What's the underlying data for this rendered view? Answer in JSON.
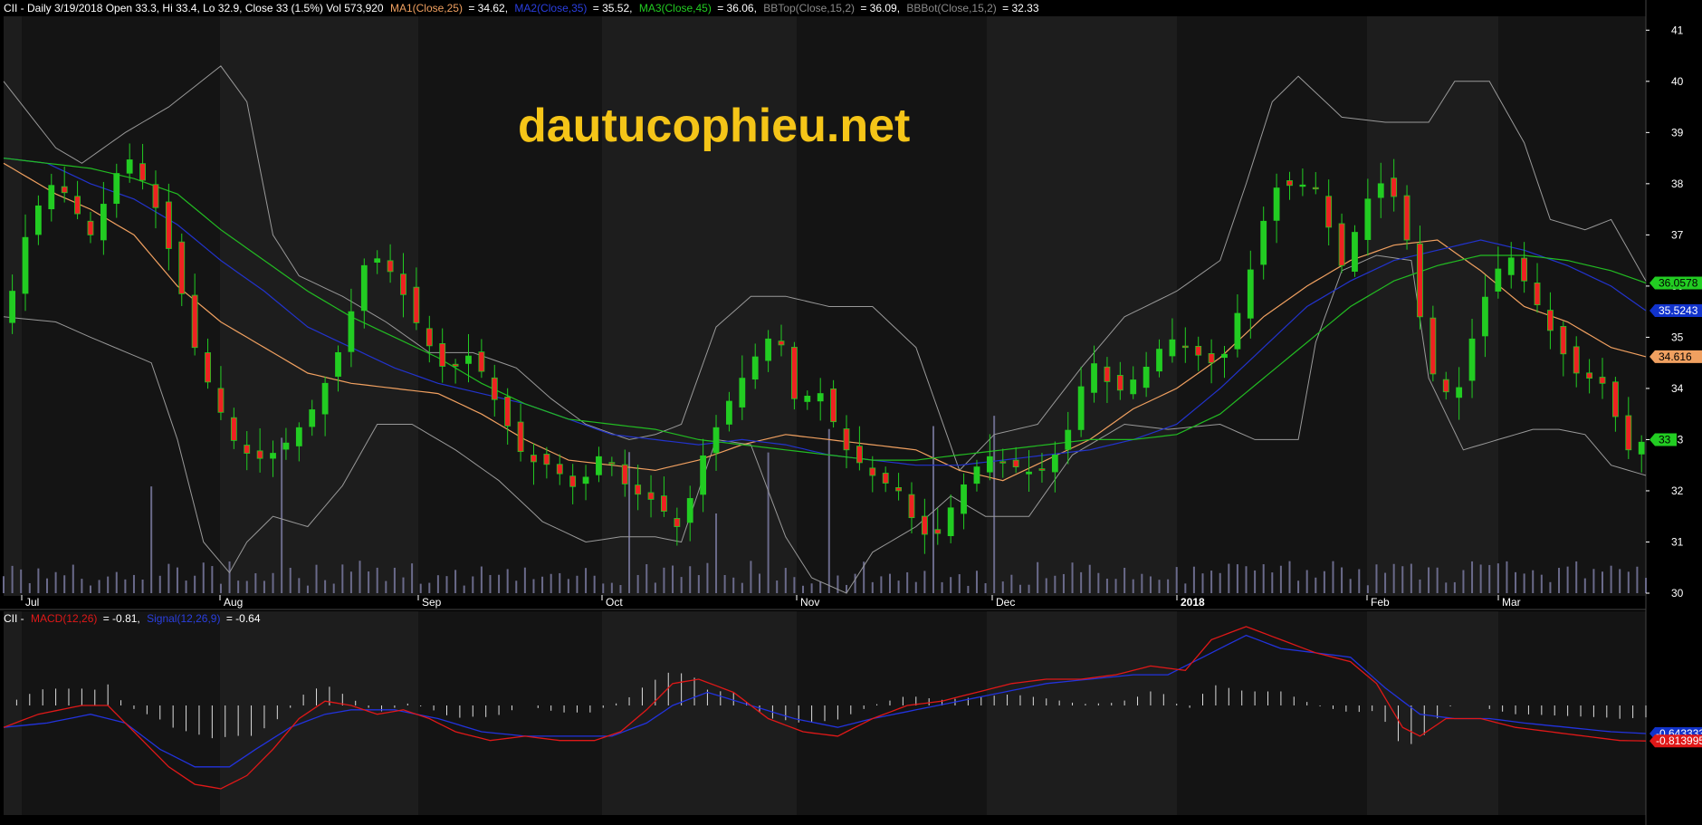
{
  "header": {
    "main_prefix": "CII - Daily 3/19/2018 Open 33.3, Hi 33.4, Lo 32.9, Close 33 (1.5%) Vol 573,920",
    "ma1_label": "MA1(Close,25)",
    "ma1_value": "= 34.62,",
    "ma2_label": "MA2(Close,35)",
    "ma2_value": "= 35.52,",
    "ma3_label": "MA3(Close,45)",
    "ma3_value": "= 36.06,",
    "bbtop_label": "BBTop(Close,15,2)",
    "bbtop_value": "= 36.09,",
    "bbbot_label": "BBBot(Close,15,2)",
    "bbbot_value": "= 32.33"
  },
  "macd_header": {
    "prefix": "CII -",
    "macd_label": "MACD(12,26)",
    "macd_value": "= -0.81,",
    "signal_label": "Signal(12,26,9)",
    "signal_value": "= -0.64"
  },
  "watermark": "dautucophieu.net",
  "colors": {
    "background": "#000000",
    "band_dark": "#141414",
    "band_light": "#1d1d1d",
    "up_candle": "#22cc22",
    "down_candle": "#ee2222",
    "ma1": "#f0a060",
    "ma2": "#2233cc",
    "ma3": "#22bb22",
    "bollinger": "#999999",
    "volume": "#6a6a8a",
    "macd": "#e01818",
    "signal": "#2233dd",
    "histogram": "#dddddd",
    "watermark": "#f5c518"
  },
  "price_tags": [
    {
      "label": "36.0578",
      "value": 36.06,
      "bg": "#22cc22",
      "fg": "#000000"
    },
    {
      "label": "35.5243",
      "value": 35.52,
      "bg": "#1133cc",
      "fg": "#ffffff"
    },
    {
      "label": "34.616",
      "value": 34.62,
      "bg": "#f0a060",
      "fg": "#000000"
    },
    {
      "label": "33",
      "value": 33.0,
      "bg": "#22cc22",
      "fg": "#000000"
    }
  ],
  "macd_tags": [
    {
      "label": "-0.643333",
      "value": -0.64,
      "bg": "#1133cc",
      "fg": "#ffffff"
    },
    {
      "label": "-0.813995",
      "value": -0.81,
      "bg": "#e01818",
      "fg": "#ffffff"
    }
  ],
  "chart_data": {
    "type": "candlestick",
    "title": "CII - Daily 3/19/2018",
    "y_ticks": [
      30,
      31,
      32,
      33,
      34,
      35,
      36,
      37,
      38,
      39,
      40,
      41
    ],
    "ylim": [
      30,
      41.2
    ],
    "months": [
      "Jul",
      "Aug",
      "Sep",
      "Oct",
      "Nov",
      "Dec",
      "2018",
      "Feb",
      "Mar"
    ],
    "close_path": [
      [
        0,
        35.2
      ],
      [
        6,
        37.3
      ],
      [
        12,
        38.1
      ],
      [
        20,
        37.0
      ],
      [
        28,
        38.6
      ],
      [
        34,
        37.8
      ],
      [
        40,
        36.2
      ],
      [
        44,
        34.8
      ],
      [
        48,
        33.9
      ],
      [
        54,
        32.8
      ],
      [
        60,
        32.6
      ],
      [
        66,
        33.0
      ],
      [
        72,
        33.7
      ],
      [
        78,
        34.9
      ],
      [
        84,
        36.7
      ],
      [
        90,
        36.2
      ],
      [
        96,
        35.1
      ],
      [
        102,
        34.3
      ],
      [
        108,
        34.7
      ],
      [
        114,
        33.6
      ],
      [
        120,
        32.6
      ],
      [
        126,
        32.5
      ],
      [
        132,
        32.0
      ],
      [
        138,
        32.8
      ],
      [
        144,
        32.0
      ],
      [
        150,
        31.8
      ],
      [
        156,
        31.2
      ],
      [
        160,
        32.5
      ],
      [
        166,
        33.6
      ],
      [
        172,
        34.5
      ],
      [
        178,
        35.2
      ],
      [
        182,
        33.8
      ],
      [
        188,
        33.9
      ],
      [
        194,
        32.8
      ],
      [
        200,
        32.3
      ],
      [
        206,
        32.0
      ],
      [
        210,
        31.3
      ],
      [
        214,
        31.0
      ],
      [
        220,
        32.0
      ],
      [
        226,
        32.7
      ],
      [
        232,
        32.5
      ],
      [
        238,
        32.3
      ],
      [
        244,
        32.9
      ],
      [
        250,
        34.6
      ],
      [
        256,
        33.9
      ],
      [
        262,
        34.3
      ],
      [
        268,
        35.0
      ],
      [
        274,
        34.7
      ],
      [
        280,
        34.4
      ],
      [
        286,
        36.0
      ],
      [
        292,
        37.9
      ],
      [
        298,
        38.0
      ],
      [
        302,
        37.9
      ],
      [
        308,
        36.4
      ],
      [
        314,
        37.7
      ],
      [
        318,
        38.1
      ],
      [
        322,
        37.4
      ],
      [
        328,
        34.4
      ],
      [
        334,
        33.7
      ],
      [
        340,
        35.6
      ],
      [
        346,
        36.7
      ],
      [
        352,
        35.8
      ],
      [
        358,
        34.8
      ],
      [
        362,
        34.3
      ],
      [
        368,
        34.1
      ],
      [
        374,
        32.8
      ],
      [
        378,
        33.0
      ]
    ],
    "bb_top_path": [
      [
        0,
        40.0
      ],
      [
        12,
        38.7
      ],
      [
        18,
        38.4
      ],
      [
        28,
        39.0
      ],
      [
        38,
        39.5
      ],
      [
        44,
        39.9
      ],
      [
        50,
        40.3
      ],
      [
        56,
        39.6
      ],
      [
        62,
        37.0
      ],
      [
        68,
        36.2
      ],
      [
        78,
        35.8
      ],
      [
        88,
        35.3
      ],
      [
        98,
        34.7
      ],
      [
        108,
        34.7
      ],
      [
        118,
        34.4
      ],
      [
        126,
        33.8
      ],
      [
        134,
        33.3
      ],
      [
        144,
        33.0
      ],
      [
        150,
        33.1
      ],
      [
        156,
        33.3
      ],
      [
        164,
        35.2
      ],
      [
        172,
        35.8
      ],
      [
        180,
        35.8
      ],
      [
        190,
        35.6
      ],
      [
        200,
        35.6
      ],
      [
        210,
        34.8
      ],
      [
        220,
        32.4
      ],
      [
        228,
        33.1
      ],
      [
        238,
        33.3
      ],
      [
        248,
        34.4
      ],
      [
        258,
        35.4
      ],
      [
        270,
        35.9
      ],
      [
        280,
        36.5
      ],
      [
        286,
        38.0
      ],
      [
        292,
        39.6
      ],
      [
        298,
        40.1
      ],
      [
        308,
        39.3
      ],
      [
        318,
        39.2
      ],
      [
        328,
        39.2
      ],
      [
        334,
        40.0
      ],
      [
        342,
        40.0
      ],
      [
        350,
        38.8
      ],
      [
        356,
        37.3
      ],
      [
        364,
        37.1
      ],
      [
        370,
        37.3
      ],
      [
        378,
        36.1
      ]
    ],
    "bb_bot_path": [
      [
        0,
        35.4
      ],
      [
        12,
        35.3
      ],
      [
        20,
        35.0
      ],
      [
        34,
        34.5
      ],
      [
        40,
        33.0
      ],
      [
        46,
        31.0
      ],
      [
        52,
        30.4
      ],
      [
        56,
        31.0
      ],
      [
        62,
        31.5
      ],
      [
        70,
        31.3
      ],
      [
        78,
        32.1
      ],
      [
        86,
        33.3
      ],
      [
        94,
        33.3
      ],
      [
        104,
        32.8
      ],
      [
        114,
        32.2
      ],
      [
        124,
        31.4
      ],
      [
        134,
        31.0
      ],
      [
        142,
        31.1
      ],
      [
        150,
        31.1
      ],
      [
        156,
        31.0
      ],
      [
        164,
        33.0
      ],
      [
        172,
        32.9
      ],
      [
        180,
        31.1
      ],
      [
        186,
        30.3
      ],
      [
        194,
        30.0
      ],
      [
        200,
        30.8
      ],
      [
        210,
        31.3
      ],
      [
        218,
        31.9
      ],
      [
        226,
        31.5
      ],
      [
        236,
        31.5
      ],
      [
        246,
        32.7
      ],
      [
        258,
        33.3
      ],
      [
        268,
        33.2
      ],
      [
        280,
        33.3
      ],
      [
        288,
        33.0
      ],
      [
        298,
        33.0
      ],
      [
        302,
        34.9
      ],
      [
        308,
        36.3
      ],
      [
        316,
        36.6
      ],
      [
        324,
        36.5
      ],
      [
        328,
        34.2
      ],
      [
        336,
        32.8
      ],
      [
        344,
        33.0
      ],
      [
        352,
        33.2
      ],
      [
        358,
        33.2
      ],
      [
        364,
        33.1
      ],
      [
        370,
        32.5
      ],
      [
        378,
        32.3
      ]
    ],
    "ma1_path": [
      [
        0,
        38.4
      ],
      [
        12,
        37.8
      ],
      [
        20,
        37.5
      ],
      [
        30,
        37.0
      ],
      [
        40,
        36.0
      ],
      [
        50,
        35.3
      ],
      [
        60,
        34.8
      ],
      [
        70,
        34.3
      ],
      [
        80,
        34.1
      ],
      [
        90,
        34.0
      ],
      [
        100,
        33.9
      ],
      [
        110,
        33.5
      ],
      [
        120,
        33.0
      ],
      [
        130,
        32.6
      ],
      [
        140,
        32.5
      ],
      [
        150,
        32.4
      ],
      [
        160,
        32.6
      ],
      [
        170,
        32.9
      ],
      [
        180,
        33.1
      ],
      [
        190,
        33.0
      ],
      [
        200,
        32.9
      ],
      [
        210,
        32.8
      ],
      [
        220,
        32.4
      ],
      [
        230,
        32.2
      ],
      [
        240,
        32.6
      ],
      [
        250,
        33.0
      ],
      [
        260,
        33.6
      ],
      [
        270,
        34.0
      ],
      [
        280,
        34.6
      ],
      [
        290,
        35.4
      ],
      [
        300,
        36.0
      ],
      [
        310,
        36.5
      ],
      [
        320,
        36.8
      ],
      [
        330,
        36.9
      ],
      [
        340,
        36.3
      ],
      [
        350,
        35.6
      ],
      [
        360,
        35.3
      ],
      [
        370,
        34.8
      ],
      [
        378,
        34.62
      ]
    ],
    "ma2_path": [
      [
        0,
        38.5
      ],
      [
        10,
        38.4
      ],
      [
        20,
        38.0
      ],
      [
        30,
        37.7
      ],
      [
        40,
        37.2
      ],
      [
        50,
        36.5
      ],
      [
        60,
        35.9
      ],
      [
        70,
        35.2
      ],
      [
        80,
        34.8
      ],
      [
        90,
        34.4
      ],
      [
        100,
        34.1
      ],
      [
        110,
        33.9
      ],
      [
        120,
        33.7
      ],
      [
        130,
        33.4
      ],
      [
        140,
        33.1
      ],
      [
        150,
        33.0
      ],
      [
        160,
        32.9
      ],
      [
        170,
        33.0
      ],
      [
        180,
        32.9
      ],
      [
        190,
        32.7
      ],
      [
        200,
        32.6
      ],
      [
        210,
        32.5
      ],
      [
        220,
        32.5
      ],
      [
        230,
        32.6
      ],
      [
        240,
        32.7
      ],
      [
        250,
        32.8
      ],
      [
        260,
        33.0
      ],
      [
        270,
        33.3
      ],
      [
        280,
        34.0
      ],
      [
        290,
        34.8
      ],
      [
        300,
        35.6
      ],
      [
        310,
        36.1
      ],
      [
        320,
        36.5
      ],
      [
        330,
        36.7
      ],
      [
        340,
        36.9
      ],
      [
        350,
        36.7
      ],
      [
        360,
        36.4
      ],
      [
        370,
        36.0
      ],
      [
        378,
        35.52
      ]
    ],
    "ma3_path": [
      [
        0,
        38.5
      ],
      [
        10,
        38.4
      ],
      [
        20,
        38.3
      ],
      [
        30,
        38.1
      ],
      [
        40,
        37.8
      ],
      [
        50,
        37.1
      ],
      [
        60,
        36.5
      ],
      [
        70,
        35.9
      ],
      [
        80,
        35.4
      ],
      [
        90,
        35.0
      ],
      [
        100,
        34.6
      ],
      [
        110,
        34.1
      ],
      [
        120,
        33.7
      ],
      [
        130,
        33.4
      ],
      [
        140,
        33.3
      ],
      [
        150,
        33.2
      ],
      [
        160,
        33.0
      ],
      [
        170,
        32.9
      ],
      [
        180,
        32.8
      ],
      [
        190,
        32.7
      ],
      [
        200,
        32.6
      ],
      [
        210,
        32.6
      ],
      [
        220,
        32.7
      ],
      [
        230,
        32.8
      ],
      [
        240,
        32.9
      ],
      [
        250,
        33.0
      ],
      [
        260,
        33.0
      ],
      [
        270,
        33.1
      ],
      [
        280,
        33.5
      ],
      [
        290,
        34.2
      ],
      [
        300,
        34.9
      ],
      [
        310,
        35.6
      ],
      [
        320,
        36.1
      ],
      [
        330,
        36.4
      ],
      [
        340,
        36.6
      ],
      [
        350,
        36.6
      ],
      [
        360,
        36.5
      ],
      [
        370,
        36.3
      ],
      [
        378,
        36.06
      ]
    ],
    "macd_ylim": [
      -2.5,
      2.5
    ],
    "macd_path": [
      [
        0,
        -0.5
      ],
      [
        8,
        -0.2
      ],
      [
        18,
        0.0
      ],
      [
        24,
        0.0
      ],
      [
        30,
        -0.6
      ],
      [
        38,
        -1.4
      ],
      [
        44,
        -1.8
      ],
      [
        50,
        -1.9
      ],
      [
        56,
        -1.6
      ],
      [
        62,
        -1.0
      ],
      [
        68,
        -0.3
      ],
      [
        74,
        0.1
      ],
      [
        80,
        0.0
      ],
      [
        86,
        -0.2
      ],
      [
        92,
        -0.1
      ],
      [
        98,
        -0.3
      ],
      [
        104,
        -0.6
      ],
      [
        112,
        -0.8
      ],
      [
        120,
        -0.7
      ],
      [
        128,
        -0.8
      ],
      [
        136,
        -0.8
      ],
      [
        142,
        -0.6
      ],
      [
        148,
        -0.1
      ],
      [
        154,
        0.5
      ],
      [
        160,
        0.6
      ],
      [
        168,
        0.3
      ],
      [
        176,
        -0.3
      ],
      [
        184,
        -0.6
      ],
      [
        192,
        -0.7
      ],
      [
        200,
        -0.3
      ],
      [
        208,
        0.0
      ],
      [
        216,
        0.1
      ],
      [
        224,
        0.3
      ],
      [
        232,
        0.5
      ],
      [
        240,
        0.6
      ],
      [
        248,
        0.6
      ],
      [
        256,
        0.7
      ],
      [
        264,
        0.9
      ],
      [
        272,
        0.8
      ],
      [
        278,
        1.5
      ],
      [
        286,
        1.8
      ],
      [
        294,
        1.5
      ],
      [
        302,
        1.2
      ],
      [
        310,
        1.0
      ],
      [
        316,
        0.5
      ],
      [
        322,
        -0.5
      ],
      [
        326,
        -0.7
      ],
      [
        332,
        -0.3
      ],
      [
        340,
        -0.3
      ],
      [
        348,
        -0.5
      ],
      [
        356,
        -0.6
      ],
      [
        364,
        -0.7
      ],
      [
        372,
        -0.8
      ],
      [
        378,
        -0.81
      ]
    ],
    "signal_path": [
      [
        0,
        -0.5
      ],
      [
        10,
        -0.4
      ],
      [
        20,
        -0.2
      ],
      [
        28,
        -0.4
      ],
      [
        36,
        -1.0
      ],
      [
        44,
        -1.4
      ],
      [
        52,
        -1.4
      ],
      [
        58,
        -1.0
      ],
      [
        66,
        -0.5
      ],
      [
        74,
        -0.2
      ],
      [
        80,
        -0.1
      ],
      [
        90,
        -0.1
      ],
      [
        100,
        -0.3
      ],
      [
        110,
        -0.6
      ],
      [
        120,
        -0.7
      ],
      [
        130,
        -0.7
      ],
      [
        140,
        -0.7
      ],
      [
        148,
        -0.4
      ],
      [
        154,
        0.0
      ],
      [
        162,
        0.3
      ],
      [
        172,
        0.0
      ],
      [
        182,
        -0.3
      ],
      [
        192,
        -0.5
      ],
      [
        200,
        -0.3
      ],
      [
        210,
        -0.1
      ],
      [
        220,
        0.1
      ],
      [
        230,
        0.3
      ],
      [
        240,
        0.5
      ],
      [
        250,
        0.6
      ],
      [
        260,
        0.7
      ],
      [
        268,
        0.7
      ],
      [
        278,
        1.2
      ],
      [
        286,
        1.6
      ],
      [
        294,
        1.3
      ],
      [
        302,
        1.2
      ],
      [
        310,
        1.1
      ],
      [
        318,
        0.4
      ],
      [
        326,
        -0.2
      ],
      [
        334,
        -0.3
      ],
      [
        342,
        -0.3
      ],
      [
        350,
        -0.4
      ],
      [
        360,
        -0.5
      ],
      [
        370,
        -0.6
      ],
      [
        378,
        -0.64
      ]
    ]
  }
}
